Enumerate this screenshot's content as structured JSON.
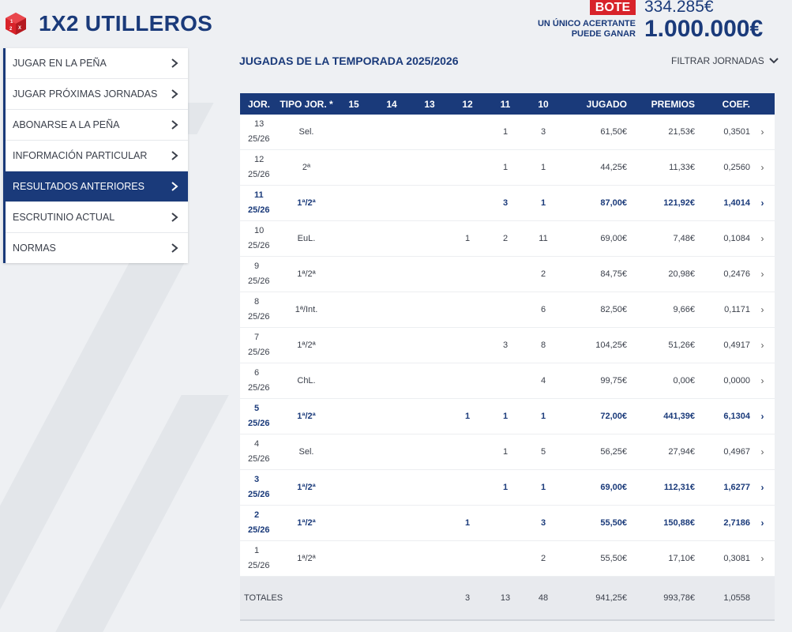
{
  "brand": {
    "name": "1X2 UTILLEROS"
  },
  "bote": {
    "badge": "BOTE",
    "amount": "334.285€",
    "subtitle_line1": "UN ÚNICO ACERTANTE",
    "subtitle_line2": "PUEDE GANAR",
    "prize": "1.000.000€"
  },
  "sidebar": {
    "items": [
      {
        "label": "JUGAR EN LA PEÑA"
      },
      {
        "label": "JUGAR PRÓXIMAS JORNADAS"
      },
      {
        "label": "ABONARSE A LA PEÑA"
      },
      {
        "label": "INFORMACIÓN PARTICULAR"
      },
      {
        "label": "RESULTADOS ANTERIORES"
      },
      {
        "label": "ESCRUTINIO ACTUAL"
      },
      {
        "label": "NORMAS"
      }
    ]
  },
  "main": {
    "title": "JUGADAS DE LA TEMPORADA 2025/2026",
    "filter_label": "FILTRAR JORNADAS"
  },
  "table": {
    "headers": [
      "JOR.",
      "TIPO JOR. *",
      "15",
      "14",
      "13",
      "12",
      "11",
      "10",
      "JUGADO",
      "PREMIOS",
      "COEF."
    ],
    "rows": [
      {
        "jor": "13",
        "season": "25/26",
        "tipo": "Sel.",
        "c15": "",
        "c14": "",
        "c13": "",
        "c12": "",
        "c11": "1",
        "c10": "3",
        "jugado": "61,50€",
        "premios": "21,53€",
        "coef": "0,3501",
        "bold": false
      },
      {
        "jor": "12",
        "season": "25/26",
        "tipo": "2ª",
        "c15": "",
        "c14": "",
        "c13": "",
        "c12": "",
        "c11": "1",
        "c10": "1",
        "jugado": "44,25€",
        "premios": "11,33€",
        "coef": "0,2560",
        "bold": false
      },
      {
        "jor": "11",
        "season": "25/26",
        "tipo": "1ª/2ª",
        "c15": "",
        "c14": "",
        "c13": "",
        "c12": "",
        "c11": "3",
        "c10": "1",
        "jugado": "87,00€",
        "premios": "121,92€",
        "coef": "1,4014",
        "bold": true
      },
      {
        "jor": "10",
        "season": "25/26",
        "tipo": "EuL.",
        "c15": "",
        "c14": "",
        "c13": "",
        "c12": "1",
        "c11": "2",
        "c10": "11",
        "jugado": "69,00€",
        "premios": "7,48€",
        "coef": "0,1084",
        "bold": false
      },
      {
        "jor": "9",
        "season": "25/26",
        "tipo": "1ª/2ª",
        "c15": "",
        "c14": "",
        "c13": "",
        "c12": "",
        "c11": "",
        "c10": "2",
        "jugado": "84,75€",
        "premios": "20,98€",
        "coef": "0,2476",
        "bold": false
      },
      {
        "jor": "8",
        "season": "25/26",
        "tipo": "1ª/Int.",
        "c15": "",
        "c14": "",
        "c13": "",
        "c12": "",
        "c11": "",
        "c10": "6",
        "jugado": "82,50€",
        "premios": "9,66€",
        "coef": "0,1171",
        "bold": false
      },
      {
        "jor": "7",
        "season": "25/26",
        "tipo": "1ª/2ª",
        "c15": "",
        "c14": "",
        "c13": "",
        "c12": "",
        "c11": "3",
        "c10": "8",
        "jugado": "104,25€",
        "premios": "51,26€",
        "coef": "0,4917",
        "bold": false
      },
      {
        "jor": "6",
        "season": "25/26",
        "tipo": "ChL.",
        "c15": "",
        "c14": "",
        "c13": "",
        "c12": "",
        "c11": "",
        "c10": "4",
        "jugado": "99,75€",
        "premios": "0,00€",
        "coef": "0,0000",
        "bold": false
      },
      {
        "jor": "5",
        "season": "25/26",
        "tipo": "1ª/2ª",
        "c15": "",
        "c14": "",
        "c13": "",
        "c12": "1",
        "c11": "1",
        "c10": "1",
        "jugado": "72,00€",
        "premios": "441,39€",
        "coef": "6,1304",
        "bold": true
      },
      {
        "jor": "4",
        "season": "25/26",
        "tipo": "Sel.",
        "c15": "",
        "c14": "",
        "c13": "",
        "c12": "",
        "c11": "1",
        "c10": "5",
        "jugado": "56,25€",
        "premios": "27,94€",
        "coef": "0,4967",
        "bold": false
      },
      {
        "jor": "3",
        "season": "25/26",
        "tipo": "1ª/2ª",
        "c15": "",
        "c14": "",
        "c13": "",
        "c12": "",
        "c11": "1",
        "c10": "1",
        "jugado": "69,00€",
        "premios": "112,31€",
        "coef": "1,6277",
        "bold": true
      },
      {
        "jor": "2",
        "season": "25/26",
        "tipo": "1ª/2ª",
        "c15": "",
        "c14": "",
        "c13": "",
        "c12": "1",
        "c11": "",
        "c10": "3",
        "jugado": "55,50€",
        "premios": "150,88€",
        "coef": "2,7186",
        "bold": true
      },
      {
        "jor": "1",
        "season": "25/26",
        "tipo": "1ª/2ª",
        "c15": "",
        "c14": "",
        "c13": "",
        "c12": "",
        "c11": "",
        "c10": "2",
        "jugado": "55,50€",
        "premios": "17,10€",
        "coef": "0,3081",
        "bold": false
      }
    ],
    "totals": {
      "label": "TOTALES",
      "c12": "3",
      "c11": "13",
      "c10": "48",
      "jugado": "941,25€",
      "premios": "993,78€",
      "coef": "1,0558"
    }
  },
  "colors": {
    "brand_blue": "#1a3a7a",
    "accent_red": "#d8232a",
    "background": "#eef0f3"
  }
}
